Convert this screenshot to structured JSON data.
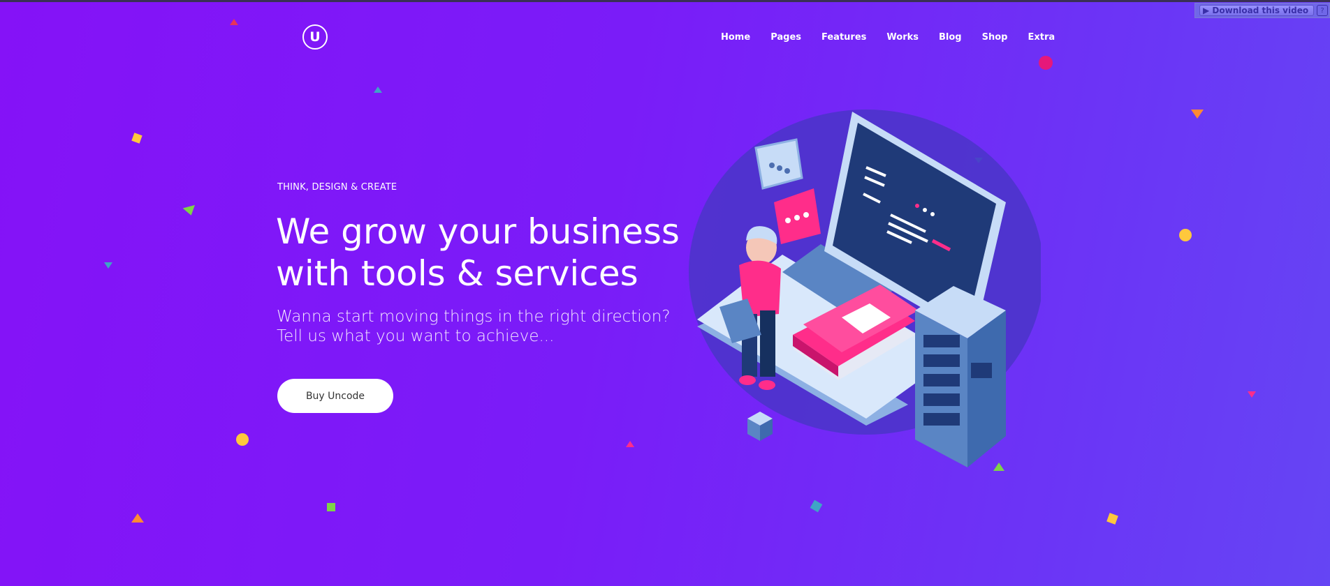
{
  "header": {
    "logo_letter": "U",
    "nav": [
      "Home",
      "Pages",
      "Features",
      "Works",
      "Blog",
      "Shop",
      "Extra"
    ],
    "download_label": "▶ Download this video",
    "download_help": "?"
  },
  "hero": {
    "eyebrow": "THINK, DESIGN & CREATE",
    "headline_line1": "We grow your business",
    "headline_line2": "with tools & services",
    "sub_line1": "Wanna start moving things in the right direction?",
    "sub_line2": "Tell us what you want to achieve...",
    "cta_label": "Buy Uncode"
  },
  "colors": {
    "background_start": "#8512f7",
    "background_end": "#6545f4",
    "accent_pink": "#ff2d8a",
    "accent_yellow": "#ffc83d",
    "screen_navy": "#1f3a78"
  }
}
